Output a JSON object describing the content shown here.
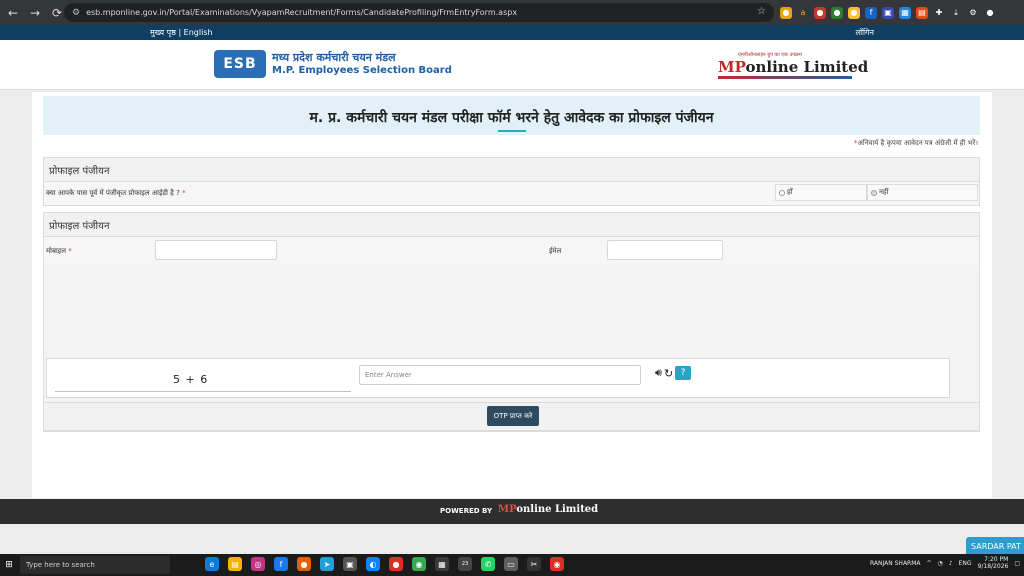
{
  "browser": {
    "url": "esb.mponline.gov.in/Portal/Examinations/VyapamRecruitment/Forms/CandidateProfiling/FrmEntryForm.aspx"
  },
  "topbar": {
    "left_text": "मुख्य पृष्ठ | English",
    "right_text": "लॉगिन"
  },
  "header": {
    "esb_mark": "ESB",
    "esb_hindi": "मध्य प्रदेश कर्मचारी चयन मंडल",
    "esb_english": "M.P. Employees Selection Board",
    "mponline_tag": "एमपीऑनलाइन ग्रुप का एक उपक्रम",
    "mponline_mp": "MP",
    "mponline_rest": "online Limited"
  },
  "page": {
    "title": "म. प्र. कर्मचारी चयन मंडल परीक्षा फॉर्म भरने हेतु आवेदक का प्रोफाइल पंजीयन",
    "mandatory_note": "अनिवार्य है कृपया आवेदन पत्र अंग्रेजी में ही भरें।"
  },
  "section1": {
    "heading": "प्रोफाइल पंजीयन",
    "question": "क्या आपके पास पूर्व में पंजीकृत प्रोफाइल आईडी है ?",
    "option_yes": "हाँ",
    "option_no": "नहीं"
  },
  "section2": {
    "heading": "प्रोफाइल पंजीयन",
    "mobile_label": "मोबाइल",
    "email_label": "ईमेल"
  },
  "captcha": {
    "expression": "5 + 6",
    "answer_placeholder": "Enter Answer"
  },
  "otp_button": "OTP प्राप्त करे",
  "footer": {
    "powered_by": "POWERED BY",
    "brand_mp": "MP",
    "brand_rest": "online Limited"
  },
  "chat_tab": "SARDAR PAT",
  "taskbar": {
    "search_placeholder": "Type here to search",
    "user": "RANJAN SHARMA",
    "lang": "ENG",
    "time": "7:20 PM",
    "date": "9/18/2026",
    "badge": "23"
  }
}
